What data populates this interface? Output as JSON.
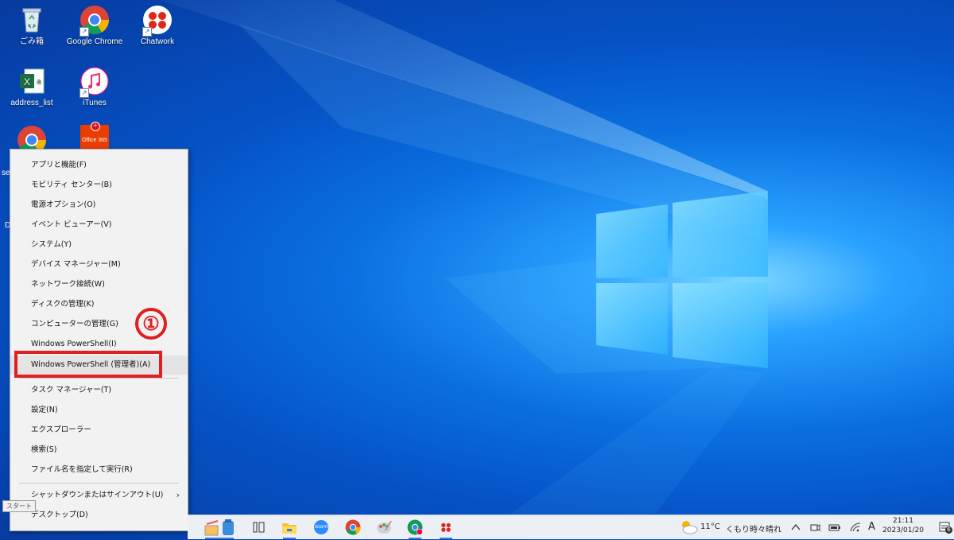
{
  "desktop": {
    "icons": [
      {
        "label": "ごみ箱"
      },
      {
        "label": "Google Chrome"
      },
      {
        "label": "Chatwork"
      },
      {
        "label": "address_list"
      },
      {
        "label": "iTunes"
      },
      {
        "label": ""
      },
      {
        "label": "Office 365"
      }
    ],
    "partial_labels": [
      "se",
      "D"
    ]
  },
  "context_menu": {
    "items": [
      {
        "label": "アプリと機能(F)"
      },
      {
        "label": "モビリティ センター(B)"
      },
      {
        "label": "電源オプション(O)"
      },
      {
        "label": "イベント ビューアー(V)"
      },
      {
        "label": "システム(Y)"
      },
      {
        "label": "デバイス マネージャー(M)"
      },
      {
        "label": "ネットワーク接続(W)"
      },
      {
        "label": "ディスクの管理(K)"
      },
      {
        "label": "コンピューターの管理(G)"
      },
      {
        "label": "Windows PowerShell(I)"
      },
      {
        "label": "Windows PowerShell (管理者)(A)"
      },
      {
        "label": "タスク マネージャー(T)"
      },
      {
        "label": "設定(N)"
      },
      {
        "label": "エクスプローラー"
      },
      {
        "label": "検索(S)"
      },
      {
        "label": "ファイル名を指定して実行(R)"
      },
      {
        "label": "シャットダウンまたはサインアウト(U)"
      },
      {
        "label": "デスクトップ(D)"
      }
    ],
    "submenu_arrow": "›",
    "highlighted_item": "Windows PowerShell (管理者)(A)"
  },
  "annotation": {
    "step_marker": "①",
    "color": "#e02020"
  },
  "start_tooltip": "スタート",
  "taskbar": {
    "icons": [
      "notepad-books-icon",
      "task-view-icon",
      "file-explorer-icon",
      "zoom-icon",
      "chrome-icon",
      "paint-icon",
      "chrome-profile-icon",
      "chatwork-icon"
    ],
    "zoom_label": "zoom",
    "weather": {
      "temp": "11°C",
      "condition": "くもり時々晴れ"
    },
    "ime": "A",
    "clock": {
      "time": "21:11",
      "date": "2023/01/20"
    },
    "notification_count": "6"
  },
  "colors": {
    "accent": "#3a7bd5",
    "highlight": "#e02020",
    "menu_bg": "#f2f2f2"
  }
}
